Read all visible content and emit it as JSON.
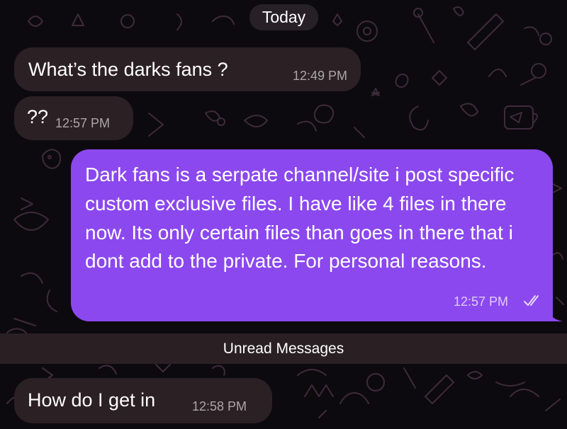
{
  "date_divider": "Today",
  "messages": [
    {
      "direction": "incoming",
      "text": "What’s the darks fans ?",
      "time": "12:49 PM"
    },
    {
      "direction": "incoming",
      "text": "??",
      "time": "12:57 PM"
    },
    {
      "direction": "outgoing",
      "text": "Dark fans is a serpate channel/site i post specific custom exclusive files. I have like 4 files in there now. Its only certain files than goes in there that i dont add to the private. For personal reasons.",
      "time": "12:57 PM",
      "status_icon": "double-check-icon"
    },
    {
      "direction": "incoming",
      "text": "How do I get in",
      "time": "12:58 PM"
    }
  ],
  "unread_divider": "Unread Messages",
  "colors": {
    "outgoing_bubble": "#8b48ef",
    "incoming_bubble": "#2b2023",
    "background": "#0d0a0f",
    "doodle": "#3b2a3a"
  }
}
